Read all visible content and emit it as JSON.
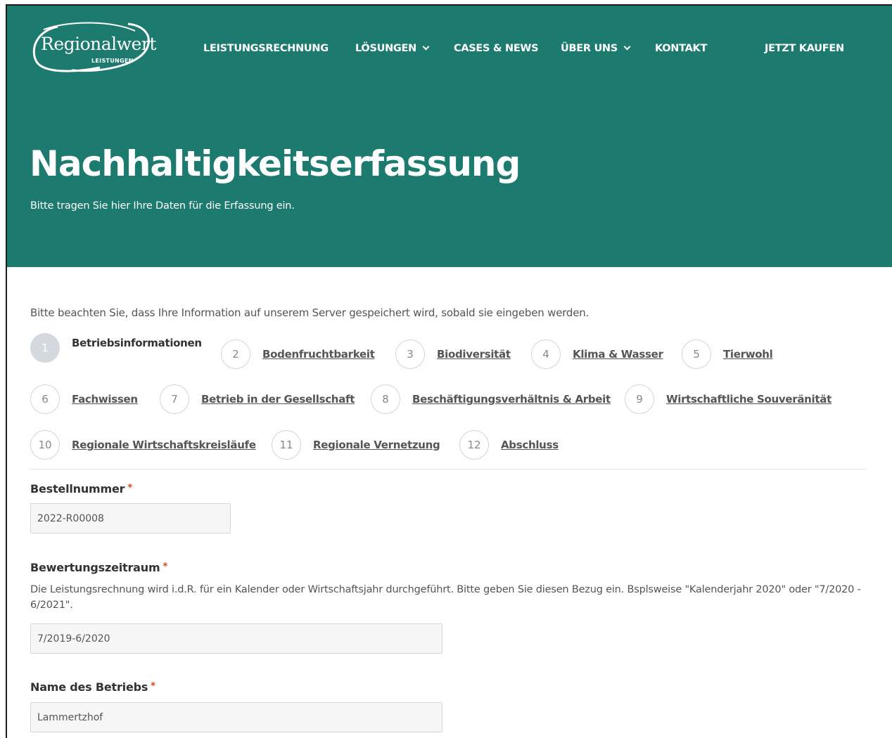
{
  "brand": {
    "logo_main": "Regionalwert",
    "logo_sub": "LEISTUNGEN"
  },
  "nav": {
    "items": [
      {
        "label": "LEISTUNGSRECHNUNG",
        "dropdown": false
      },
      {
        "label": "LÖSUNGEN",
        "dropdown": true
      },
      {
        "label": "CASES & NEWS",
        "dropdown": false
      },
      {
        "label": "ÜBER UNS",
        "dropdown": true
      },
      {
        "label": "KONTAKT",
        "dropdown": false
      }
    ],
    "cta": "JETZT KAUFEN"
  },
  "hero": {
    "title": "Nachhaltigkeitserfassung",
    "subtitle": "Bitte tragen Sie hier Ihre Daten für die Erfassung ein."
  },
  "notice": "Bitte beachten Sie, dass Ihre Information auf unserem Server gespeichert wird, sobald sie eingeben werden.",
  "steps": [
    {
      "num": "1",
      "label": "Betriebsinformationen",
      "active": true
    },
    {
      "num": "2",
      "label": "Bodenfruchtbarkeit",
      "active": false
    },
    {
      "num": "3",
      "label": "Biodiversität",
      "active": false
    },
    {
      "num": "4",
      "label": "Klima & Wasser",
      "active": false
    },
    {
      "num": "5",
      "label": "Tierwohl",
      "active": false
    },
    {
      "num": "6",
      "label": "Fachwissen",
      "active": false
    },
    {
      "num": "7",
      "label": "Betrieb in der Gesellschaft",
      "active": false
    },
    {
      "num": "8",
      "label": "Beschäftigungsverhältnis & Arbeit",
      "active": false
    },
    {
      "num": "9",
      "label": "Wirtschaftliche Souveränität",
      "active": false
    },
    {
      "num": "10",
      "label": "Regionale Wirtschaftskreisläufe",
      "active": false
    },
    {
      "num": "11",
      "label": "Regionale Vernetzung",
      "active": false
    },
    {
      "num": "12",
      "label": "Abschluss",
      "active": false
    }
  ],
  "form": {
    "order_number": {
      "label": "Bestellnummer",
      "required_mark": "*",
      "value": "2022-R00008"
    },
    "period": {
      "label": "Bewertungszeitraum",
      "required_mark": "*",
      "help": "Die Leistungsrechnung wird i.d.R. für ein Kalender oder Wirtschaftsjahr durchgeführt. Bitte geben Sie diesen Bezug ein. Bsplsweise \"Kalenderjahr 2020\" oder \"7/2020 - 6/2021\".",
      "value": "7/2019-6/2020"
    },
    "farm_name": {
      "label": "Name des Betriebs",
      "required_mark": "*",
      "value": "Lammertzhof"
    }
  },
  "colors": {
    "hero_bg": "#1d7a6e",
    "required": "#e2401c",
    "active_step": "#d4d8df"
  }
}
